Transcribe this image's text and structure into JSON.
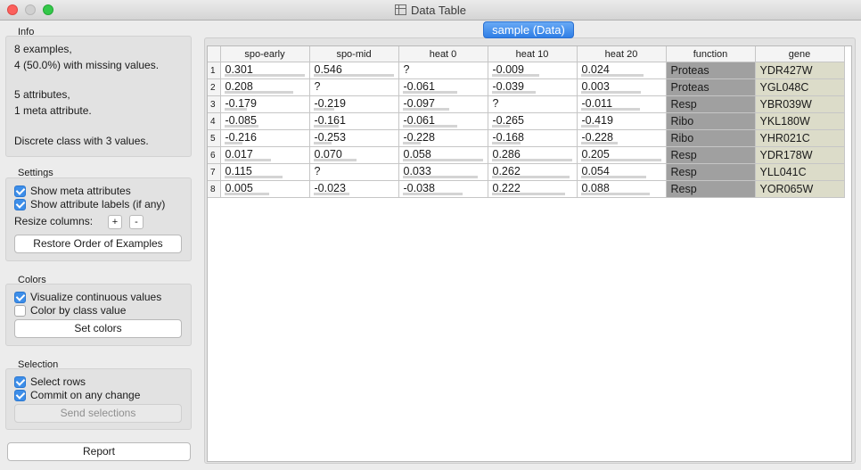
{
  "window": {
    "title": "Data Table"
  },
  "info": {
    "label": "Info",
    "lines": [
      "8 examples,",
      "4 (50.0%) with missing values.",
      "5 attributes,",
      "1 meta attribute.",
      "Discrete class with 3 values."
    ]
  },
  "settings": {
    "label": "Settings",
    "show_meta": "Show meta attributes",
    "show_labels": "Show attribute labels (if any)",
    "resize_label": "Resize columns:",
    "plus": "+",
    "minus": "-",
    "restore": "Restore Order of Examples"
  },
  "colors": {
    "label": "Colors",
    "visualize": "Visualize continuous values",
    "by_class": "Color by class value",
    "set_colors": "Set colors"
  },
  "selection": {
    "label": "Selection",
    "select_rows": "Select rows",
    "commit": "Commit on any change",
    "send": "Send selections"
  },
  "report": "Report",
  "tab": "sample (Data)",
  "table": {
    "headers": [
      "spo-early",
      "spo-mid",
      "heat 0",
      "heat 10",
      "heat 20",
      "function",
      "gene"
    ],
    "rows": [
      {
        "n": "1",
        "spo_early": "0.301",
        "spo_mid": "0.546",
        "heat0": "?",
        "heat10": "-0.009",
        "heat20": "0.024",
        "function": "Proteas",
        "gene": "YDR427W"
      },
      {
        "n": "2",
        "spo_early": "0.208",
        "spo_mid": "?",
        "heat0": "-0.061",
        "heat10": "-0.039",
        "heat20": "0.003",
        "function": "Proteas",
        "gene": "YGL048C"
      },
      {
        "n": "3",
        "spo_early": "-0.179",
        "spo_mid": "-0.219",
        "heat0": "-0.097",
        "heat10": "?",
        "heat20": "-0.011",
        "function": "Resp",
        "gene": "YBR039W"
      },
      {
        "n": "4",
        "spo_early": "-0.085",
        "spo_mid": "-0.161",
        "heat0": "-0.061",
        "heat10": "-0.265",
        "heat20": "-0.419",
        "function": "Ribo",
        "gene": "YKL180W"
      },
      {
        "n": "5",
        "spo_early": "-0.216",
        "spo_mid": "-0.253",
        "heat0": "-0.228",
        "heat10": "-0.168",
        "heat20": "-0.228",
        "function": "Ribo",
        "gene": "YHR021C"
      },
      {
        "n": "6",
        "spo_early": "0.017",
        "spo_mid": "0.070",
        "heat0": "0.058",
        "heat10": "0.286",
        "heat20": "0.205",
        "function": "Resp",
        "gene": "YDR178W"
      },
      {
        "n": "7",
        "spo_early": "0.115",
        "spo_mid": "?",
        "heat0": "0.033",
        "heat10": "0.262",
        "heat20": "0.054",
        "function": "Resp",
        "gene": "YLL041C"
      },
      {
        "n": "8",
        "spo_early": "0.005",
        "spo_mid": "-0.023",
        "heat0": "-0.038",
        "heat10": "0.222",
        "heat20": "0.088",
        "function": "Resp",
        "gene": "YOR065W"
      }
    ]
  },
  "style": {
    "accent": "#3d8ee9",
    "class_bg": "#a0a0a0",
    "meta_bg": "#dcdcc9"
  }
}
